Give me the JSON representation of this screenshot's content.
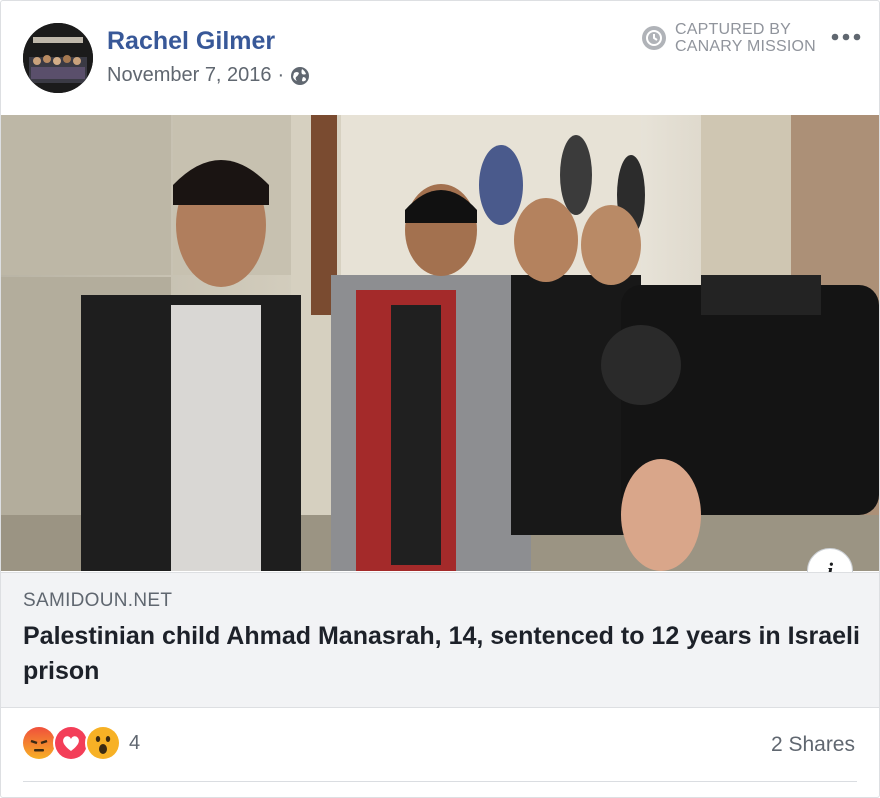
{
  "post": {
    "author": "Rachel Gilmer",
    "date": "November 7, 2016",
    "separator": "·",
    "audience_icon": "globe-icon"
  },
  "badge": {
    "line1": "CAPTURED BY",
    "line2": "CANARY MISSION",
    "icon": "clock-icon"
  },
  "more_icon": "more-options-icon",
  "link": {
    "domain": "SAMIDOUN.NET",
    "headline": "Palestinian child Ahmad Manasrah, 14, sentenced to 12 years in Israeli prison",
    "info_label": "i"
  },
  "footer": {
    "reactions": [
      "angry",
      "love",
      "wow"
    ],
    "reaction_count": "4",
    "shares": "2 Shares"
  },
  "colors": {
    "author_link": "#385898",
    "secondary_text": "#606770",
    "link_bg": "#f2f3f5",
    "angry": "#e9710f",
    "love": "#f33e58",
    "wow": "#f7b125"
  }
}
